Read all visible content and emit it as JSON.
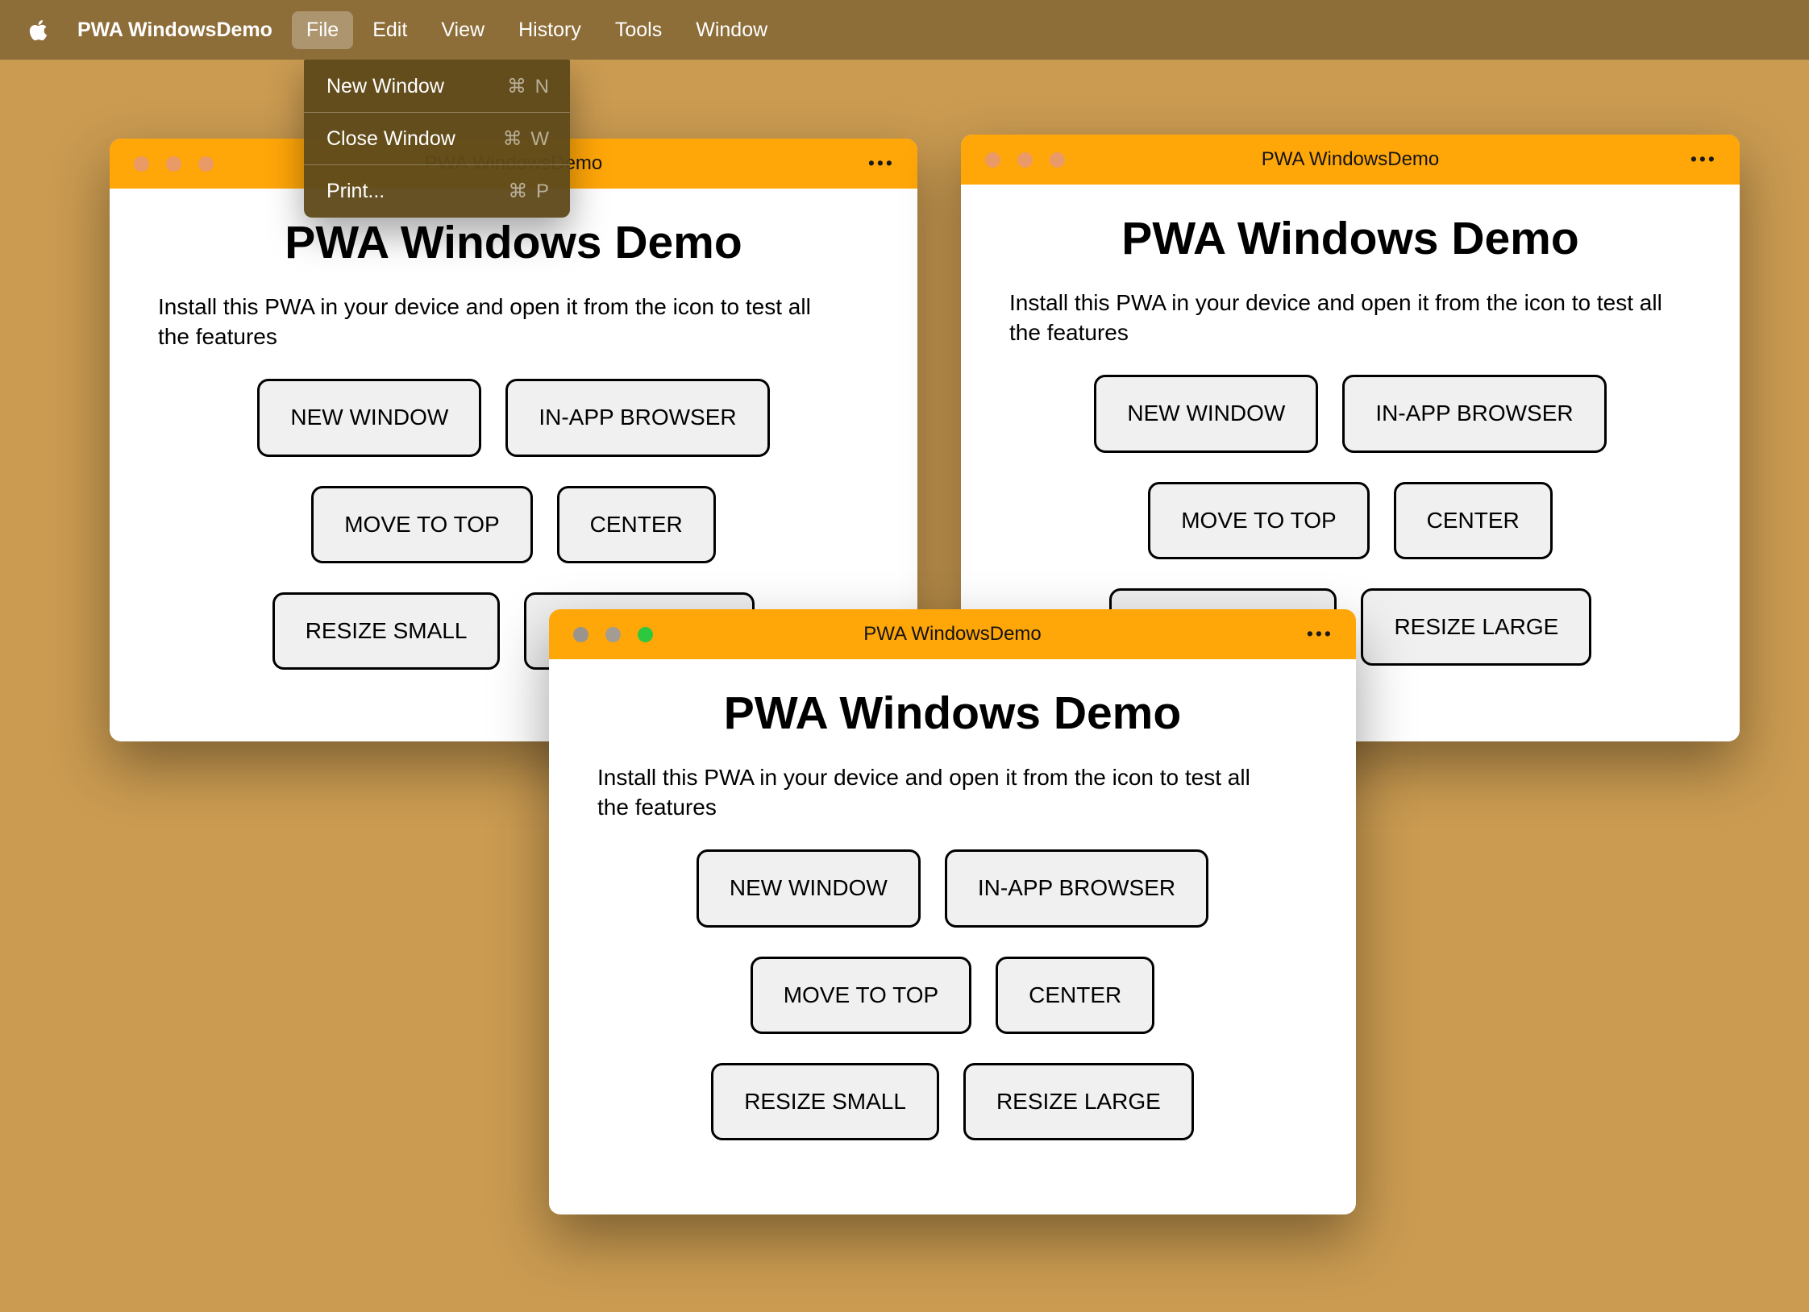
{
  "menu_bar": {
    "app_name": "PWA WindowsDemo",
    "menus": [
      "File",
      "Edit",
      "View",
      "History",
      "Tools",
      "Window"
    ],
    "active_menu": "File"
  },
  "file_menu": {
    "items": [
      {
        "label": "New Window",
        "shortcut": "⌘ N"
      },
      {
        "label": "Close Window",
        "shortcut": "⌘ W"
      },
      {
        "label": "Print...",
        "shortcut": "⌘ P"
      }
    ]
  },
  "window_content": {
    "titlebar_title": "PWA WindowsDemo",
    "heading": "PWA Windows Demo",
    "description": "Install this PWA in your device and open it from the icon to test all the features",
    "buttons": [
      "NEW WINDOW",
      "IN-APP BROWSER",
      "MOVE TO TOP",
      "CENTER",
      "RESIZE SMALL",
      "RESIZE LARGE"
    ]
  },
  "icons": {
    "ellipsis": "•••"
  },
  "theme": {
    "desktop_bg": "#ca9b51",
    "menubar_bg": "#8d6d38",
    "menu_highlight": "rgba(255,255,255,0.28)",
    "dropdown_bg": "rgba(95,74,26,0.96)",
    "titlebar_bg": "#ffa608",
    "button_bg": "#f0f0f0",
    "light_inactive": "#ea9a66",
    "light_front_1": "#9a948c",
    "light_front_2": "#a39c92",
    "light_green": "#2bc840"
  }
}
